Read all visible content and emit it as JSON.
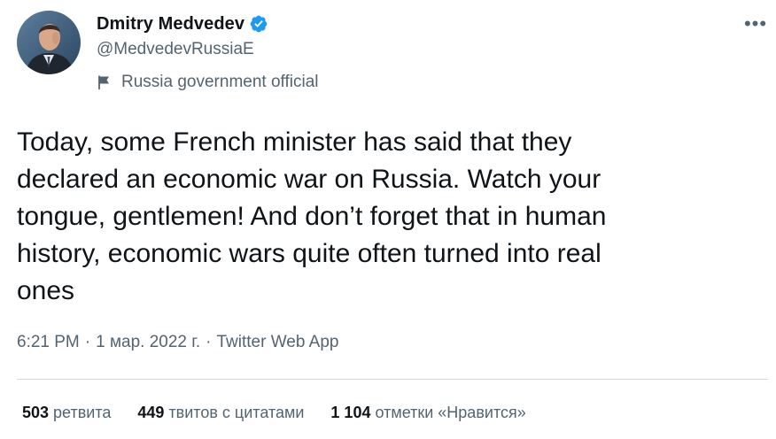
{
  "author": {
    "display_name": "Dmitry Medvedev",
    "handle": "@MedvedevRussiaE",
    "label": "Russia government official",
    "verified": true,
    "verified_icon": "verified-badge-icon",
    "label_icon": "flag-icon"
  },
  "more_icon": "more-icon",
  "more_glyph": "•••",
  "tweet": {
    "text": "Today, some French minister has said that they\ndeclared an economic war on Russia. Watch your\ntongue, gentlemen! And don’t forget that in human\nhistory, economic wars quite often turned into real\nones"
  },
  "meta": {
    "time": "6:21 PM",
    "separator": "·",
    "date": "1 мар. 2022 г.",
    "source": "Twitter Web App"
  },
  "stats": [
    {
      "count": "503",
      "label": "ретвита"
    },
    {
      "count": "449",
      "label": "твитов с цитатами"
    },
    {
      "count": "1 104",
      "label": "отметки «Нравится»"
    }
  ],
  "colors": {
    "text_primary": "#0f1419",
    "text_secondary": "#536471",
    "verified_blue": "#1d9bf0",
    "divider": "#cfd9de"
  }
}
